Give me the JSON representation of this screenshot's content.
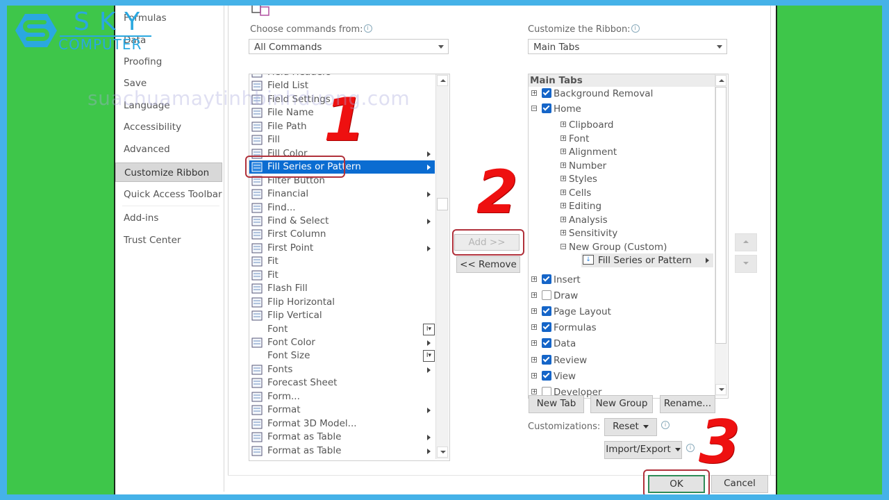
{
  "logo": {
    "line1": "SKY",
    "line2": "COMPUTER",
    "brand_color": "#2aa8e0"
  },
  "watermark": "suachuamaytinhbinhduong.com",
  "sidebar": {
    "items": [
      {
        "label": "Formulas"
      },
      {
        "label": "Data"
      },
      {
        "label": "Proofing"
      },
      {
        "label": "Save"
      },
      {
        "label": "Language"
      },
      {
        "label": "Accessibility"
      },
      {
        "label": "Advanced"
      },
      {
        "label": "Customize Ribbon",
        "active": true
      },
      {
        "label": "Quick Access Toolbar"
      },
      {
        "label": "Add-ins"
      },
      {
        "label": "Trust Center"
      }
    ]
  },
  "commands": {
    "label": "Choose commands from:",
    "selected": "All Commands",
    "items": [
      {
        "label": "Field Headers",
        "icon": "field-headers-icon"
      },
      {
        "label": "Field List",
        "icon": "field-list-icon"
      },
      {
        "label": "Field Settings",
        "icon": "field-settings-icon"
      },
      {
        "label": "File Name",
        "icon": "excel-file-icon"
      },
      {
        "label": "File Path",
        "icon": "file-path-icon"
      },
      {
        "label": "Fill",
        "icon": "fill-image-icon"
      },
      {
        "label": "Fill Color",
        "icon": "paint-bucket-icon",
        "submenu": true
      },
      {
        "label": "Fill Series or Pattern",
        "icon": "fill-series-icon",
        "submenu": true,
        "selected": true
      },
      {
        "label": "Filter Button",
        "icon": "checkmark-icon"
      },
      {
        "label": "Financial",
        "icon": "financial-icon",
        "submenu": true
      },
      {
        "label": "Find...",
        "icon": "magnifier-icon"
      },
      {
        "label": "Find & Select",
        "icon": "magnifier-icon",
        "submenu": true
      },
      {
        "label": "First Column",
        "icon": "checkmark-icon"
      },
      {
        "label": "First Point",
        "icon": "first-point-icon",
        "submenu": true
      },
      {
        "label": "Fit",
        "icon": "fit-arrows-icon"
      },
      {
        "label": "Fit",
        "icon": "fit-image-icon"
      },
      {
        "label": "Flash Fill",
        "icon": "flash-fill-icon"
      },
      {
        "label": "Flip Horizontal",
        "icon": "flip-horizontal-icon"
      },
      {
        "label": "Flip Vertical",
        "icon": "flip-vertical-icon"
      },
      {
        "label": "Font",
        "icon": "",
        "combo": true
      },
      {
        "label": "Font Color",
        "icon": "font-color-icon",
        "submenu": true
      },
      {
        "label": "Font Size",
        "icon": "",
        "combo": true
      },
      {
        "label": "Fonts",
        "icon": "fonts-icon",
        "submenu": true
      },
      {
        "label": "Forecast Sheet",
        "icon": "forecast-sheet-icon"
      },
      {
        "label": "Form...",
        "icon": "form-icon"
      },
      {
        "label": "Format",
        "icon": "format-icon",
        "submenu": true
      },
      {
        "label": "Format 3D Model...",
        "icon": "3d-model-icon"
      },
      {
        "label": "Format as Table",
        "icon": "format-table-icon",
        "submenu": true
      },
      {
        "label": "Format as Table",
        "icon": "format-table-icon",
        "submenu": true
      }
    ]
  },
  "actions": {
    "add": "Add >>",
    "remove": "<< Remove"
  },
  "ribbon": {
    "label": "Customize the Ribbon:",
    "selected": "Main Tabs",
    "header": "Main Tabs",
    "tree": [
      {
        "label": "Background Removal",
        "level": 0,
        "expander": "+",
        "checked": true
      },
      {
        "label": "Home",
        "level": 0,
        "expander": "-",
        "checked": true
      },
      {
        "label": "Clipboard",
        "level": 1,
        "expander": "+"
      },
      {
        "label": "Font",
        "level": 1,
        "expander": "+"
      },
      {
        "label": "Alignment",
        "level": 1,
        "expander": "+"
      },
      {
        "label": "Number",
        "level": 1,
        "expander": "+"
      },
      {
        "label": "Styles",
        "level": 1,
        "expander": "+"
      },
      {
        "label": "Cells",
        "level": 1,
        "expander": "+"
      },
      {
        "label": "Editing",
        "level": 1,
        "expander": "+"
      },
      {
        "label": "Analysis",
        "level": 1,
        "expander": "+"
      },
      {
        "label": "Sensitivity",
        "level": 1,
        "expander": "+"
      },
      {
        "label": "New Group (Custom)",
        "level": 1,
        "expander": "-"
      },
      {
        "label": "Fill Series or Pattern",
        "level": 2,
        "highlighted": true,
        "submenu": true
      },
      {
        "label": "Insert",
        "level": 0,
        "expander": "+",
        "checked": true
      },
      {
        "label": "Draw",
        "level": 0,
        "expander": "+",
        "checked": false
      },
      {
        "label": "Page Layout",
        "level": 0,
        "expander": "+",
        "checked": true
      },
      {
        "label": "Formulas",
        "level": 0,
        "expander": "+",
        "checked": true
      },
      {
        "label": "Data",
        "level": 0,
        "expander": "+",
        "checked": true
      },
      {
        "label": "Review",
        "level": 0,
        "expander": "+",
        "checked": true
      },
      {
        "label": "View",
        "level": 0,
        "expander": "+",
        "checked": true
      },
      {
        "label": "Developer",
        "level": 0,
        "expander": "+",
        "checked": false
      }
    ],
    "buttons": {
      "new_tab": "New Tab",
      "new_group": "New Group",
      "rename": "Rename..."
    },
    "customizations_label": "Customizations:",
    "reset": "Reset",
    "import_export": "Import/Export"
  },
  "footer": {
    "ok": "OK",
    "cancel": "Cancel"
  },
  "steps": [
    "1",
    "2",
    "3"
  ]
}
